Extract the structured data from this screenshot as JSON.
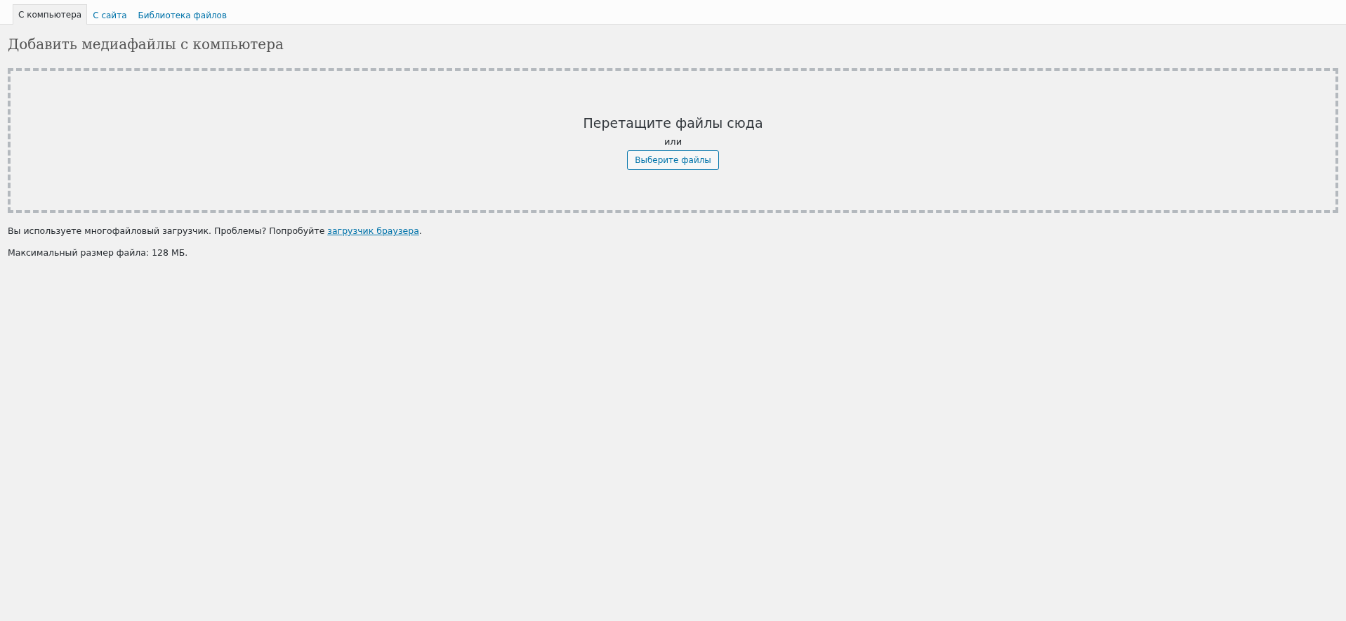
{
  "tabs": [
    {
      "label": "С компьютера",
      "selected": true
    },
    {
      "label": "С сайта",
      "selected": false
    },
    {
      "label": "Библиотека файлов",
      "selected": false
    }
  ],
  "heading": "Добавить медиафайлы с компьютера",
  "dropzone": {
    "title": "Перетащите файлы сюда",
    "or": "или",
    "button": "Выберите файлы"
  },
  "notice": {
    "text": "Вы используете многофайловый загрузчик. Проблемы? Попробуйте ",
    "link": "загрузчик браузера",
    "after": "."
  },
  "max_size": "Максимальный размер файла: 128 МБ."
}
